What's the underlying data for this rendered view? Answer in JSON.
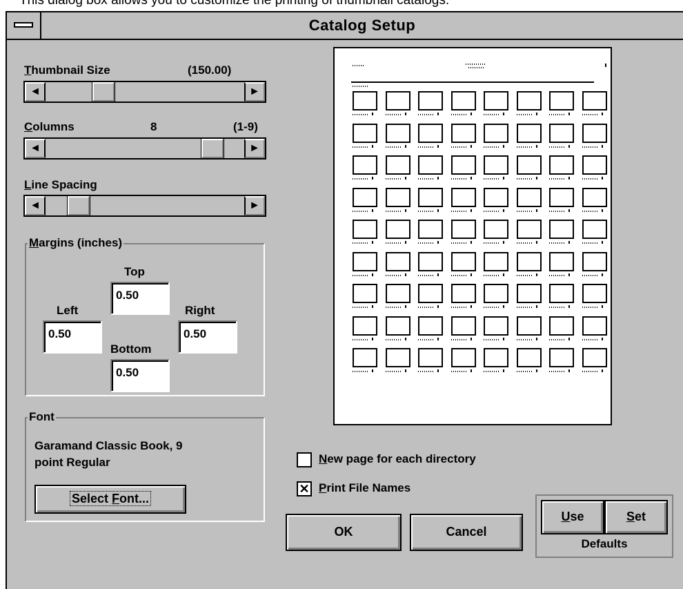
{
  "caption": "This dialog box allows you to customize the printing of thumbnail catalogs.",
  "window": {
    "title": "Catalog Setup"
  },
  "thumbnail_size": {
    "label_prefix": "T",
    "label_rest": "humbnail Size",
    "value": "(150.00)",
    "slider_position": 0.22
  },
  "columns": {
    "label_prefix": "C",
    "label_rest": "olumns",
    "value": "8",
    "range": "(1-9)",
    "slider_position": 0.875
  },
  "line_spacing": {
    "label_prefix": "L",
    "label_rest": "ine Spacing",
    "slider_position": 0.1
  },
  "margins": {
    "title_prefix": "M",
    "title_rest": "argins (inches)",
    "top_label": "Top",
    "top_value": "0.50",
    "left_label": "Left",
    "left_value": "0.50",
    "right_label": "Right",
    "right_value": "0.50",
    "bottom_label": "Bottom",
    "bottom_value": "0.50"
  },
  "font": {
    "title": "Font",
    "line1": "Garamand Classic Book, 9",
    "line2": "point Regular",
    "select_prefix": "Select ",
    "select_key": "F",
    "select_rest": "ont..."
  },
  "options": {
    "new_page": {
      "key": "N",
      "rest": "ew page for each directory",
      "checked": false
    },
    "print_names": {
      "key": "P",
      "rest": "rint File Names",
      "checked": true,
      "mark": "✕"
    }
  },
  "buttons": {
    "ok": "OK",
    "cancel": "Cancel"
  },
  "defaults": {
    "use_key": "U",
    "use_rest": "se",
    "set_key": "S",
    "set_rest": "et",
    "label": "Defaults"
  },
  "preview": {
    "columns": 8,
    "rows": 9
  },
  "icons": {
    "left_arrow": "◄",
    "right_arrow": "►"
  },
  "colors": {
    "face": "#c0c0c0",
    "shadow": "#808080",
    "highlight": "#ffffff"
  }
}
